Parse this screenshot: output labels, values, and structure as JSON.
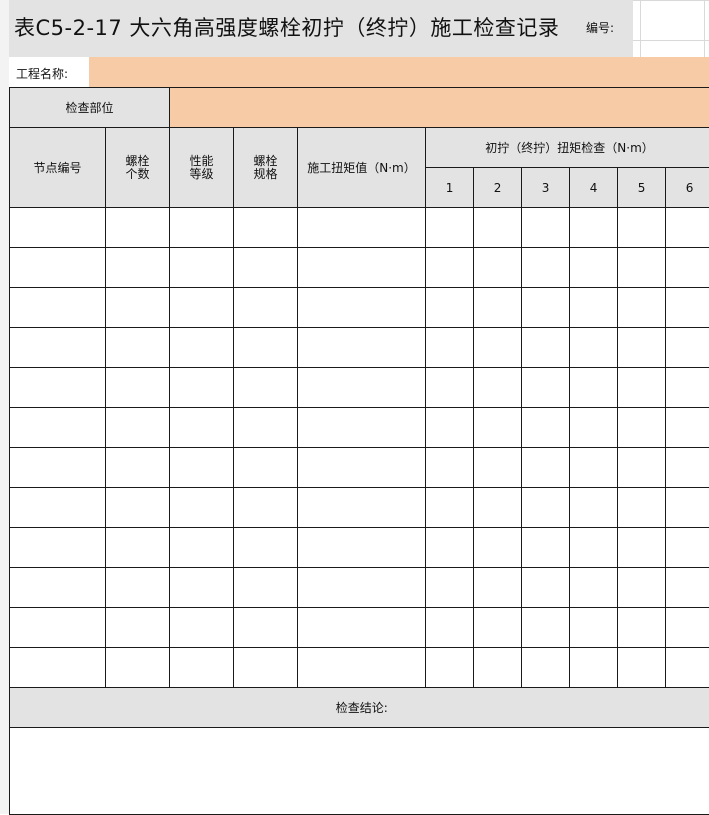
{
  "header": {
    "title": "表C5-2-17 大六角高强度螺栓初拧（终拧）施工检查记录",
    "code_label": "编号:"
  },
  "project": {
    "label": "工程名称:",
    "value": ""
  },
  "inspection": {
    "location_label": "检查部位",
    "location_value": ""
  },
  "table": {
    "columns": {
      "node_no": "节点编号",
      "bolt_count": "螺栓\n个数",
      "grade": "性能\n等级",
      "spec": "螺栓\n规格",
      "torque_value": "施工扭矩值（N·m）",
      "check_group": "初拧（终拧）扭矩检查（N·m）",
      "check_numbers": [
        "1",
        "2",
        "3",
        "4",
        "5",
        "6"
      ]
    },
    "row_count": 12
  },
  "conclusion": {
    "label": "检查结论:"
  }
}
